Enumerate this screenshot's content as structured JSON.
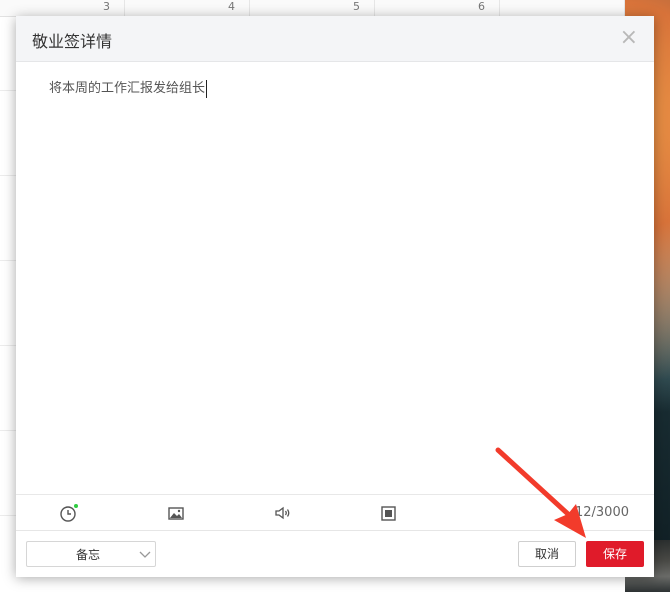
{
  "background_app": {
    "header_cells": [
      "3",
      "4",
      "5",
      "6",
      ""
    ]
  },
  "dialog": {
    "title": "敬业签详情",
    "close_glyph": "×",
    "editor_text": "将本周的工作汇报发给组长",
    "toolbar": {
      "icons": [
        "clock-icon",
        "image-icon",
        "speaker-icon",
        "stop-square-icon"
      ],
      "reminder_dot_color": "#2ecc40",
      "char_counter": "12/3000"
    },
    "footer": {
      "category_select": "备忘",
      "cancel_label": "取消",
      "save_label": "保存"
    }
  },
  "colors": {
    "save_button": "#e01b2a",
    "annotation_arrow": "#f23b2b"
  }
}
